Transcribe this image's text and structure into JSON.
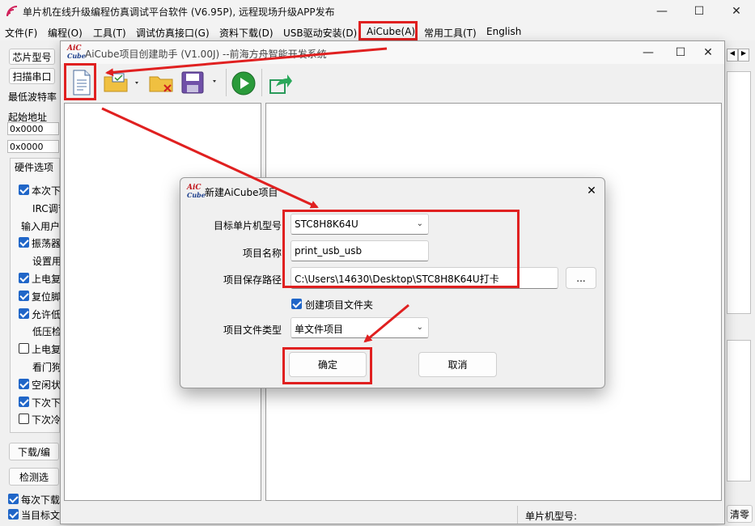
{
  "app": {
    "title": "单片机在线升级编程仿真调试平台软件 (V6.95P), 远程现场升级APP发布"
  },
  "menu": [
    "文件(F)",
    "编程(O)",
    "工具(T)",
    "调试仿真接口(G)",
    "资料下载(D)",
    "USB驱动安装(D)",
    "AiCube(A)",
    "常用工具(T)",
    "English"
  ],
  "left": {
    "chip_btn": "芯片型号",
    "scan_btn": "扫描串口",
    "min_baud": "最低波特率",
    "start_addr": "起始地址",
    "addr1": "0x0000",
    "addr2": "0x0000",
    "hw_tab": "硬件选项",
    "options": [
      {
        "label": "本次下",
        "checked": true
      },
      {
        "label": "IRC调节",
        "checked": null
      },
      {
        "label": "输入用户",
        "checked": null
      },
      {
        "label": "振荡器",
        "checked": true
      },
      {
        "label": "设置用",
        "checked": null
      },
      {
        "label": "上电复",
        "checked": true
      },
      {
        "label": "复位脚",
        "checked": true
      },
      {
        "label": "允许低",
        "checked": true
      },
      {
        "label": "低压检",
        "checked": null
      },
      {
        "label": "上电复",
        "checked": false
      },
      {
        "label": "看门狗",
        "checked": null
      },
      {
        "label": "空闲状",
        "checked": true
      },
      {
        "label": "下次下",
        "checked": true
      },
      {
        "label": "下次冷",
        "checked": false
      }
    ],
    "download_btn": "下载/编",
    "detect_btn": "检测选",
    "each_download": "每次下载",
    "current_target": "当目标文"
  },
  "right": {
    "clear_btn": "清零"
  },
  "aicube": {
    "title": "AiCube项目创建助手 (V1.00J) --前海方舟智能开发系统",
    "logo_top": "AiC",
    "logo_bottom": "Cube",
    "status_label": "单片机型号:"
  },
  "dialog": {
    "title": "新建AiCube项目",
    "mcu_label": "目标单片机型号",
    "mcu_value": "STC8H8K64U",
    "name_label": "项目名称",
    "name_value": "print_usb_usb",
    "path_label": "项目保存路径",
    "path_value": "C:\\Users\\14630\\Desktop\\STC8H8K64U打卡",
    "browse": "...",
    "create_folder": "创建项目文件夹",
    "create_folder_checked": true,
    "type_label": "项目文件类型",
    "type_value": "单文件项目",
    "ok": "确定",
    "cancel": "取消"
  }
}
